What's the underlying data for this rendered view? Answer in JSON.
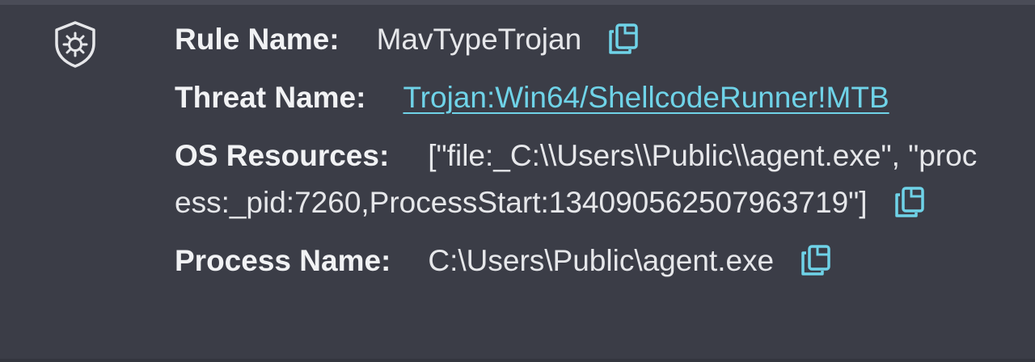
{
  "rule": {
    "label": "Rule Name:",
    "value": "MavTypeTrojan"
  },
  "threat": {
    "label": "Threat Name:",
    "value": "Trojan:Win64/ShellcodeRunner!MTB"
  },
  "os_resources": {
    "label": "OS Resources:",
    "value": "[\"file:_C:\\\\Users\\\\Public\\\\agent.exe\", \"process:_pid:7260,ProcessStart:134090562507963719\"]"
  },
  "process": {
    "label": "Process Name:",
    "value": "C:\\Users\\Public\\agent.exe"
  },
  "icons": {
    "alert": "shield-alert-icon",
    "copy": "copy-icon"
  },
  "colors": {
    "background": "#3b3d47",
    "text": "#e6e7ea",
    "link": "#6fd3e8",
    "icon_accent": "#6fd3e8"
  }
}
